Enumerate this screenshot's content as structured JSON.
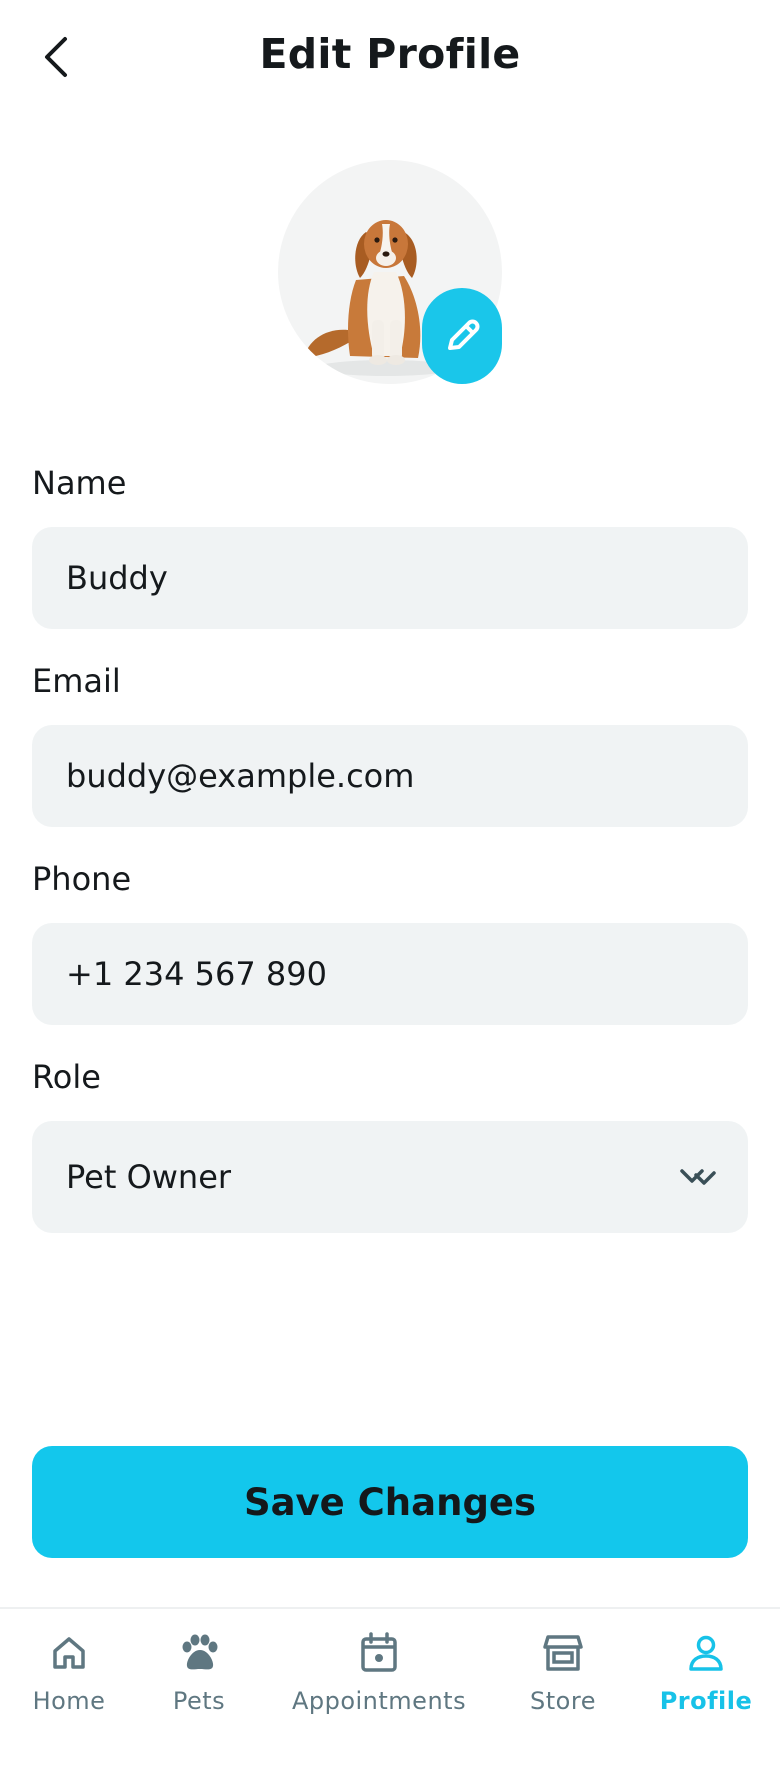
{
  "header": {
    "title": "Edit Profile",
    "back_icon": "chevron-left-icon"
  },
  "avatar": {
    "subject": "dog photo",
    "edit_icon": "pencil-icon",
    "accent_color": "#1ac6ea"
  },
  "form": {
    "name": {
      "label": "Name",
      "value": "Buddy"
    },
    "email": {
      "label": "Email",
      "value": "buddy@example.com"
    },
    "phone": {
      "label": "Phone",
      "value": "+1 234 567 890"
    },
    "role": {
      "label": "Role",
      "value": "Pet Owner",
      "icon": "chevron-down-icon"
    }
  },
  "actions": {
    "save_label": "Save Changes",
    "save_color": "#13c7ec"
  },
  "bottom_nav": {
    "items": [
      {
        "label": "Home",
        "icon": "home-icon"
      },
      {
        "label": "Pets",
        "icon": "paw-icon"
      },
      {
        "label": "Appointments",
        "icon": "calendar-icon"
      },
      {
        "label": "Store",
        "icon": "store-icon"
      },
      {
        "label": "Profile",
        "icon": "person-icon"
      }
    ],
    "active": "Profile",
    "active_color": "#17c2e8",
    "inactive_color": "#5f7781"
  }
}
